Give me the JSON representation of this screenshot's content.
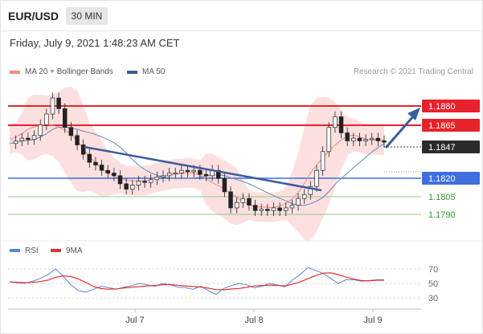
{
  "header": {
    "pair": "EUR/USD",
    "timeframe": "30 MIN"
  },
  "date_text": "Friday, July 9, 2021 1:48:23 AM CET",
  "legend": {
    "ma20": {
      "label": "MA 20 + Bollinger Bands",
      "color": "#f08a8a"
    },
    "ma50": {
      "label": "MA 50",
      "color": "#3a5e9c"
    },
    "copyright": "Research © 2021 Trading Central"
  },
  "rsi_legend": {
    "rsi": {
      "label": "RSI",
      "color": "#5b87d9"
    },
    "ma9": {
      "label": "9MA",
      "color": "#e03030"
    }
  },
  "levels": [
    {
      "value": "1.1880",
      "kind": "resistance",
      "color": "#e8222a"
    },
    {
      "value": "1.1865",
      "kind": "resistance",
      "color": "#e8222a"
    },
    {
      "value": "1.1847",
      "kind": "current",
      "color": "#333333"
    },
    {
      "value": "1.1820",
      "kind": "pivot",
      "color": "#3d6fe0"
    },
    {
      "value": "1.1805",
      "kind": "support",
      "color": "#2e9b2e"
    },
    {
      "value": "1.1790",
      "kind": "support",
      "color": "#2e9b2e"
    }
  ],
  "x_labels": [
    "Jul 7",
    "Jul 8",
    "Jul 9"
  ],
  "rsi_ticks": [
    "70",
    "50",
    "30"
  ],
  "chart_data": {
    "type": "candlestick",
    "instrument": "EUR/USD",
    "interval": "30 MIN",
    "y_range_approx": [
      1.1777,
      1.1892
    ],
    "price_series_approx": [
      1.1846,
      1.1848,
      1.185,
      1.1849,
      1.1852,
      1.186,
      1.1868,
      1.188,
      1.1872,
      1.1858,
      1.1852,
      1.1845,
      1.1838,
      1.1832,
      1.183,
      1.1826,
      1.1824,
      1.1822,
      1.1816,
      1.1812,
      1.1815,
      1.1818,
      1.1817,
      1.1819,
      1.1821,
      1.1822,
      1.1824,
      1.1824,
      1.1826,
      1.1825,
      1.1826,
      1.1823,
      1.1822,
      1.1826,
      1.182,
      1.181,
      1.1798,
      1.1802,
      1.1805,
      1.18,
      1.1796,
      1.1797,
      1.1796,
      1.1798,
      1.1796,
      1.1798,
      1.18,
      1.1805,
      1.1808,
      1.1814,
      1.1826,
      1.184,
      1.1858,
      1.1866,
      1.1854,
      1.1848,
      1.185,
      1.1848,
      1.1849,
      1.185,
      1.1848,
      1.1847
    ],
    "rsi_series_approx": [
      52,
      51,
      50,
      53,
      57,
      62,
      70,
      60,
      48,
      40,
      38,
      42,
      46,
      44,
      42,
      45,
      47,
      50,
      48,
      46,
      50,
      48,
      45,
      44,
      42,
      46,
      40,
      35,
      43,
      47,
      50,
      48,
      44,
      46,
      50,
      48,
      45,
      55,
      62,
      72,
      68,
      64,
      57,
      50,
      55,
      55,
      53,
      54,
      55,
      55
    ],
    "rsi_ticks": [
      70,
      50,
      30
    ],
    "x_labels": [
      "Jul 7",
      "Jul 8",
      "Jul 9"
    ]
  }
}
